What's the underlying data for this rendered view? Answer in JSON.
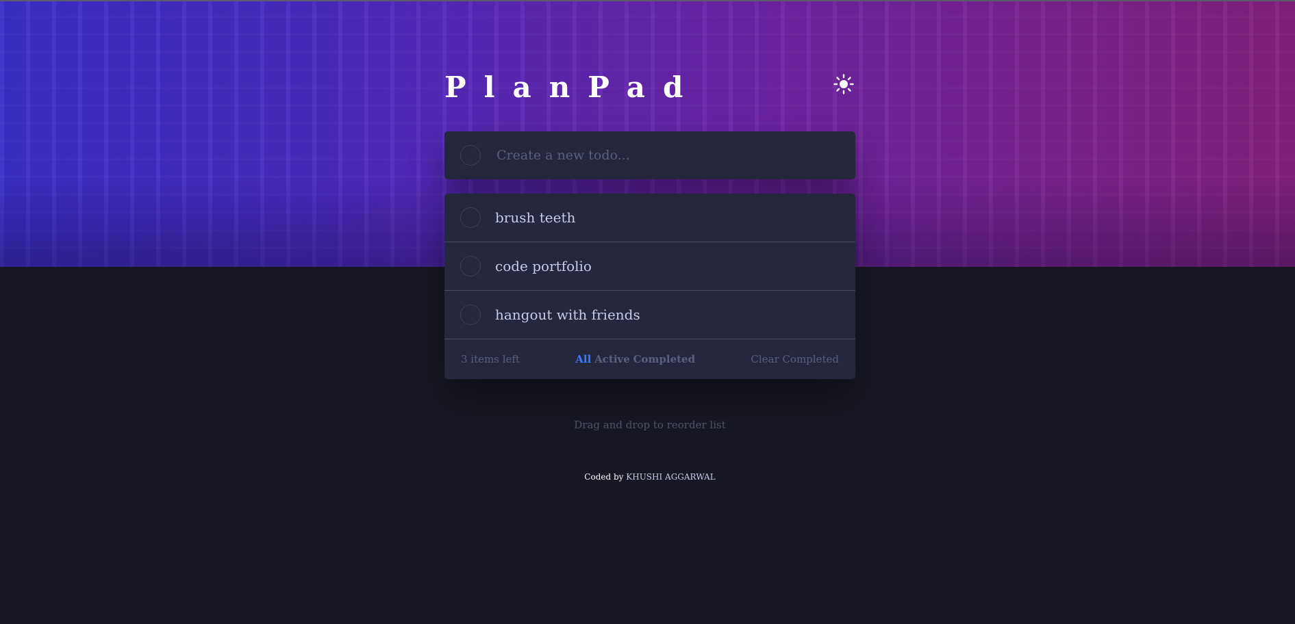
{
  "app": {
    "title": "PlanPad"
  },
  "colors": {
    "accent": "#3a7bfd",
    "card": "#25273d",
    "background": "#181824"
  },
  "header": {
    "theme_toggle_icon": "sun-icon"
  },
  "new_todo": {
    "placeholder": "Create a new todo..."
  },
  "todos": [
    {
      "text": "brush teeth",
      "completed": false
    },
    {
      "text": "code portfolio",
      "completed": false
    },
    {
      "text": "hangout with friends",
      "completed": false
    }
  ],
  "footer": {
    "items_left": "3 items left",
    "filters": [
      "All",
      "Active",
      "Completed"
    ],
    "active_filter": "All",
    "clear_label": "Clear Completed"
  },
  "hint": "Drag and drop to reorder list",
  "credit": {
    "prefix": "Coded by",
    "author": "KHUSHI AGGARWAL"
  }
}
